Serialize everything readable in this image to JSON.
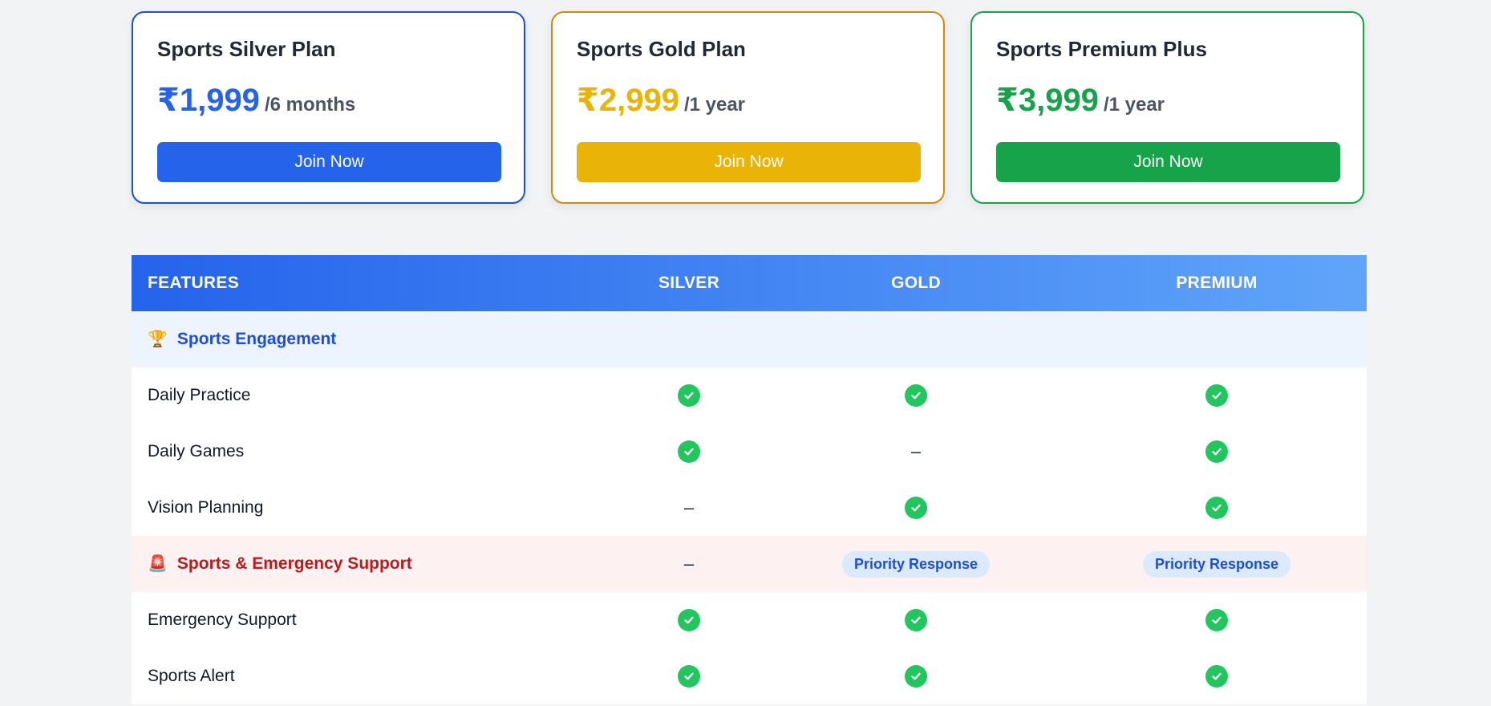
{
  "plans": [
    {
      "title": "Sports Silver Plan",
      "price": "₹1,999",
      "period": "/6 months",
      "button": "Join Now",
      "accent": "#2563eb"
    },
    {
      "title": "Sports Gold Plan",
      "price": "₹2,999",
      "period": "/1 year",
      "button": "Join Now",
      "accent": "#eab308"
    },
    {
      "title": "Sports Premium Plus",
      "price": "₹3,999",
      "period": "/1 year",
      "button": "Join Now",
      "accent": "#16a34a"
    }
  ],
  "table": {
    "headers": [
      "FEATURES",
      "SILVER",
      "GOLD",
      "PREMIUM"
    ],
    "sections": [
      {
        "label": "Sports Engagement",
        "icon": "trophy-icon",
        "icon_glyph": "🏆",
        "color": "#1d4ed8",
        "values": [
          "",
          "",
          ""
        ]
      },
      {
        "label": "Daily Practice",
        "values": [
          "check",
          "check",
          "check"
        ]
      },
      {
        "label": "Daily Games",
        "values": [
          "check",
          "–",
          "check"
        ]
      },
      {
        "label": "Vision Planning",
        "values": [
          "–",
          "check",
          "check"
        ]
      },
      {
        "label": "Sports & Emergency Support",
        "icon": "siren-icon",
        "icon_glyph": "🚨",
        "color": "#b91c1c",
        "values": [
          "–",
          "Priority Response",
          "Priority Response"
        ]
      },
      {
        "label": "Emergency Support",
        "values": [
          "check",
          "check",
          "check"
        ]
      },
      {
        "label": "Sports Alert",
        "values": [
          "check",
          "check",
          "check"
        ]
      }
    ]
  },
  "colors": {
    "check": "#22c55e",
    "header_start": "#2563eb",
    "header_end": "#60a5fa"
  }
}
